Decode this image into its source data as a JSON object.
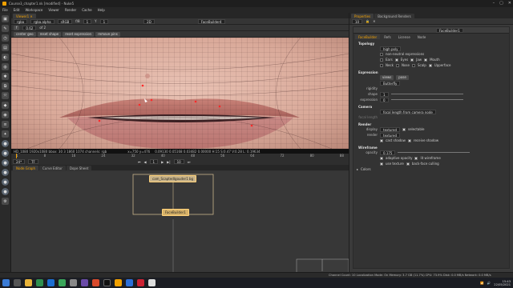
{
  "app": {
    "title": "Course3_chapter1.nk [modified] - Nuke5",
    "menus": [
      "File",
      "Edit",
      "Workspace",
      "Viewer",
      "Render",
      "Cache",
      "Help"
    ]
  },
  "viewer": {
    "tab_label": "Viewer1",
    "channel": "rgba",
    "alpha": "rgba.alpha",
    "colorspace": "sRGB",
    "gain_label": "f/8",
    "gain_value": "1",
    "y_label": "Y",
    "y_value": "1",
    "cam": "2D",
    "node_input": "FaceBuilder4",
    "frame_value": "0.62",
    "frame_prefix": "f",
    "frame_count": "of 2",
    "buttons": [
      "center geo",
      "reset shape",
      "reset expression",
      "remove pins"
    ],
    "info_left": "HD_1080 1920x1080  bbox: 30 3 1860 1074 channels: rgb",
    "info_right": "x=750 y=476",
    "info_values": "0.09130  0.05168  0.03482  0.00000   H:15 S:0.47 V:0.28  L: 0.19634",
    "timeline_ticks": [
      "1",
      "8",
      "16",
      "24",
      "32",
      "40",
      "48",
      "56",
      "64",
      "72",
      "80",
      "88"
    ],
    "fps": "24*",
    "tf": "TF",
    "playhead_frame": "1",
    "increment": "10"
  },
  "nodegraph": {
    "tabs": [
      "Node Graph",
      "Curve Editor",
      "Dope Sheet"
    ],
    "node_top": "cam_ScaptedIgouder1 bg",
    "node_bottom": "FaceBuilder1"
  },
  "properties": {
    "tabs": [
      "Properties",
      "Background Renders"
    ],
    "count": "10",
    "node_name": "FaceBuilder1",
    "subtabs": [
      "FaceBuilder",
      "Refs",
      "License",
      "Node"
    ],
    "topology_header": "Topology",
    "topology_value": "high poly",
    "checks": {
      "nonneutral": "non-neutral expressions",
      "ears": "Ears",
      "eyes": "Eyes",
      "jaw": "Jaw",
      "mouth": "Mouth",
      "neck": "Neck",
      "nose": "Nose",
      "scalp": "Scalp",
      "upperface": "Upperface"
    },
    "expression_header": "Expression",
    "expr_buttons": [
      "views",
      "pose"
    ],
    "expr_value": "Butterfly",
    "rigidity_label": "rigidity",
    "shape_label": "shape",
    "shape_value": "1",
    "expression_label": "expression",
    "expression_value": "0",
    "camera_header": "Camera",
    "camera_value": "focal length from camera node",
    "focal_label": "focal length",
    "render_header": "Render",
    "display_label": "display",
    "display_value": "textured",
    "selectable": "selectable",
    "render_label": "render",
    "render_value": "textured",
    "cast_shadow": "cast shadow",
    "receive_shadow": "receive shadow",
    "wireframe_header": "Wireframe",
    "opacity_label": "opacity",
    "opacity_value": "0.175",
    "adaptive_opacity": "adaptive opacity",
    "lit_wireframe": "lit wireframe",
    "use_texture": "use texture",
    "backface": "back-face culling",
    "colors": "Colors"
  },
  "statusbar": {
    "text": "Channel Count: 10  Localization Mode: On  Memory: 3.7 GB (11.7%)  CPU: 73.9%  Disk: 0.0 MB/s  Network: 0.0 MB/s"
  },
  "taskbar": {
    "time": "15:43",
    "date": "22/05/2021"
  }
}
